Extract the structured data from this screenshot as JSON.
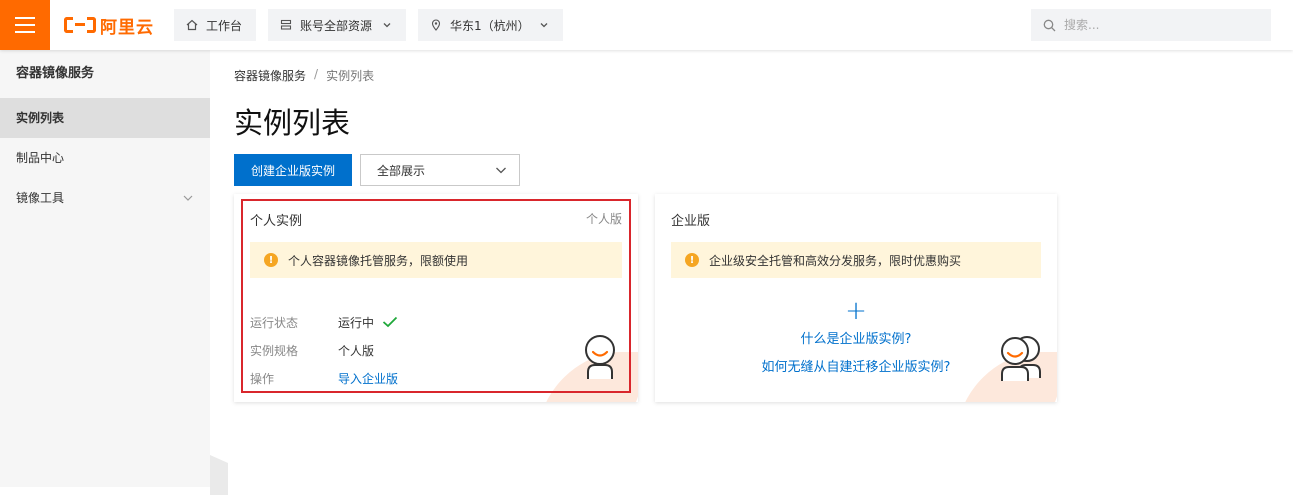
{
  "header": {
    "logo_text": "阿里云",
    "home_label": "工作台",
    "resources_label": "账号全部资源",
    "region_label": "华东1（杭州）",
    "search_placeholder": "搜索..."
  },
  "sidebar": {
    "title": "容器镜像服务",
    "items": [
      {
        "label": "实例列表",
        "active": true
      },
      {
        "label": "制品中心",
        "active": false
      },
      {
        "label": "镜像工具",
        "active": false,
        "expandable": true
      }
    ]
  },
  "breadcrumb": {
    "root": "容器镜像服务",
    "separator": "/",
    "current": "实例列表"
  },
  "page_title": "实例列表",
  "toolbar": {
    "create_label": "创建企业版实例",
    "filter_value": "全部展示"
  },
  "cards": {
    "personal": {
      "title": "个人实例",
      "tag": "个人版",
      "notice": "个人容器镜像托管服务，限额使用",
      "rows": {
        "status_label": "运行状态",
        "status_value": "运行中",
        "spec_label": "实例规格",
        "spec_value": "个人版",
        "action_label": "操作",
        "action_link": "导入企业版"
      }
    },
    "enterprise": {
      "title": "企业版",
      "notice": "企业级安全托管和高效分发服务，限时优惠购买",
      "plus": "+",
      "link_what": "什么是企业版实例?",
      "link_migrate": "如何无缝从自建迁移企业版实例?"
    }
  },
  "colors": {
    "brand": "#ff6a00",
    "primary": "#0070cc",
    "highlight_border": "#d9262c",
    "notice_bg": "#fff5db",
    "success": "#1fa83a"
  }
}
